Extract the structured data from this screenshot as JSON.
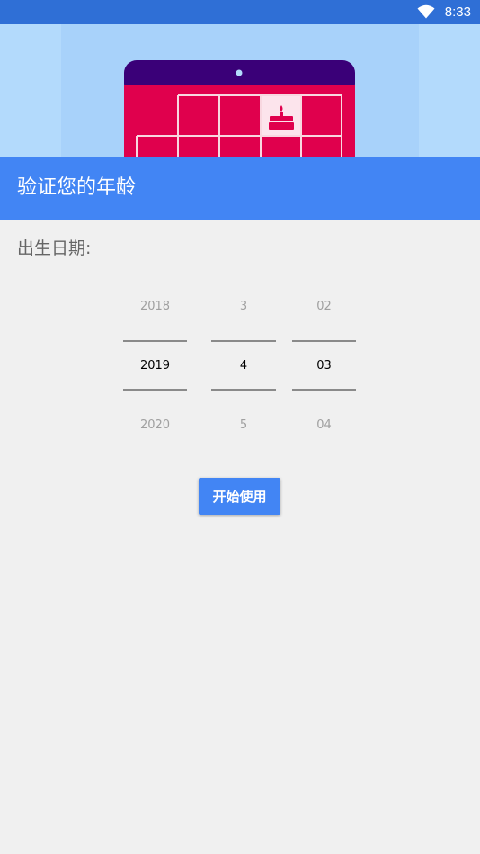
{
  "status_bar": {
    "time": "8:33",
    "icon": "wifi-icon"
  },
  "hero": {
    "icon": "birthday-cake-icon",
    "colors": {
      "background": "#b3dafc",
      "calendar_header": "#3a0078",
      "calendar_body": "#e0004d",
      "highlight_cell": "#fce4ec"
    }
  },
  "app_bar": {
    "title": "验证您的年龄",
    "color": "#4285f4"
  },
  "form": {
    "dob_label": "出生日期:",
    "picker": {
      "year": {
        "prev": "2018",
        "selected": "2019",
        "next": "2020"
      },
      "month": {
        "prev": "3",
        "selected": "4",
        "next": "5"
      },
      "day": {
        "prev": "02",
        "selected": "03",
        "next": "04"
      }
    },
    "start_button": "开始使用"
  }
}
